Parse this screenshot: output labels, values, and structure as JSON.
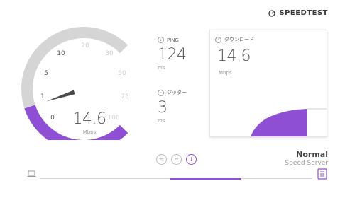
{
  "brand": {
    "name": "SPEEDTEST",
    "logo_icon": "speedometer-icon"
  },
  "gauge": {
    "value": "14.6",
    "unit": "Mbps",
    "max": 100,
    "labels": [
      "0",
      "1",
      "5",
      "10",
      "20",
      "30",
      "50",
      "75",
      "100"
    ],
    "fill_color": "#8e4fd4",
    "track_color": "#d5d5d5"
  },
  "ping": {
    "label": "PING",
    "value": "124",
    "unit": "ms",
    "icon": "ping-icon"
  },
  "jitter": {
    "label": "ジッター",
    "value": "3",
    "unit": "ms",
    "icon": "jitter-icon"
  },
  "download": {
    "label": "ダウンロード",
    "value": "14.6",
    "unit": "Mbps",
    "icon": "download-circle-icon"
  },
  "controls": [
    {
      "name": "connections-icon",
      "active": false
    },
    {
      "name": "wave-icon",
      "active": false
    },
    {
      "name": "download-arrow-icon",
      "active": true
    }
  ],
  "server": {
    "name": "Normal",
    "subtitle": "Speed Server"
  },
  "progress": {
    "fraction": 0.26
  },
  "colors": {
    "accent": "#8e4fd4"
  }
}
